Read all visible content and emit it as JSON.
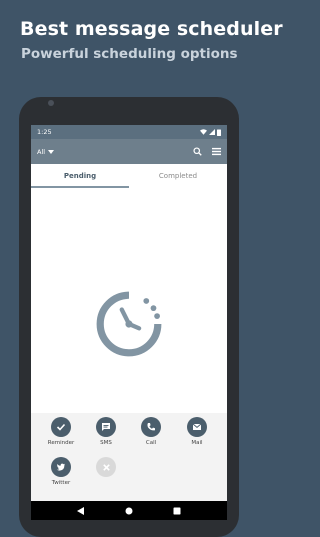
{
  "promo": {
    "headline": "Best message scheduler",
    "subline": "Powerful scheduling options"
  },
  "status_bar": {
    "time": "1:25"
  },
  "app_bar": {
    "filter_label": "All"
  },
  "tabs": [
    {
      "label": "Pending",
      "active": true
    },
    {
      "label": "Completed",
      "active": false
    }
  ],
  "actions": [
    {
      "label": "Reminder",
      "icon": "check-icon",
      "color": "#4b5e6c"
    },
    {
      "label": "SMS",
      "icon": "sms-icon",
      "color": "#4b5e6c"
    },
    {
      "label": "Call",
      "icon": "phone-icon",
      "color": "#4b5e6c"
    },
    {
      "label": "Mail",
      "icon": "mail-icon",
      "color": "#4b5e6c"
    },
    {
      "label": "Twitter",
      "icon": "twitter-icon",
      "color": "#4b5e6c"
    },
    {
      "label": "",
      "icon": "close-icon",
      "color": "#d9d9d9"
    }
  ],
  "colors": {
    "background": "#3f5467",
    "app_bar": "#6e7f8c",
    "status_bar": "#5b6f7f",
    "accent": "#4b5e6c",
    "empty_state_icon": "#8295a3"
  }
}
